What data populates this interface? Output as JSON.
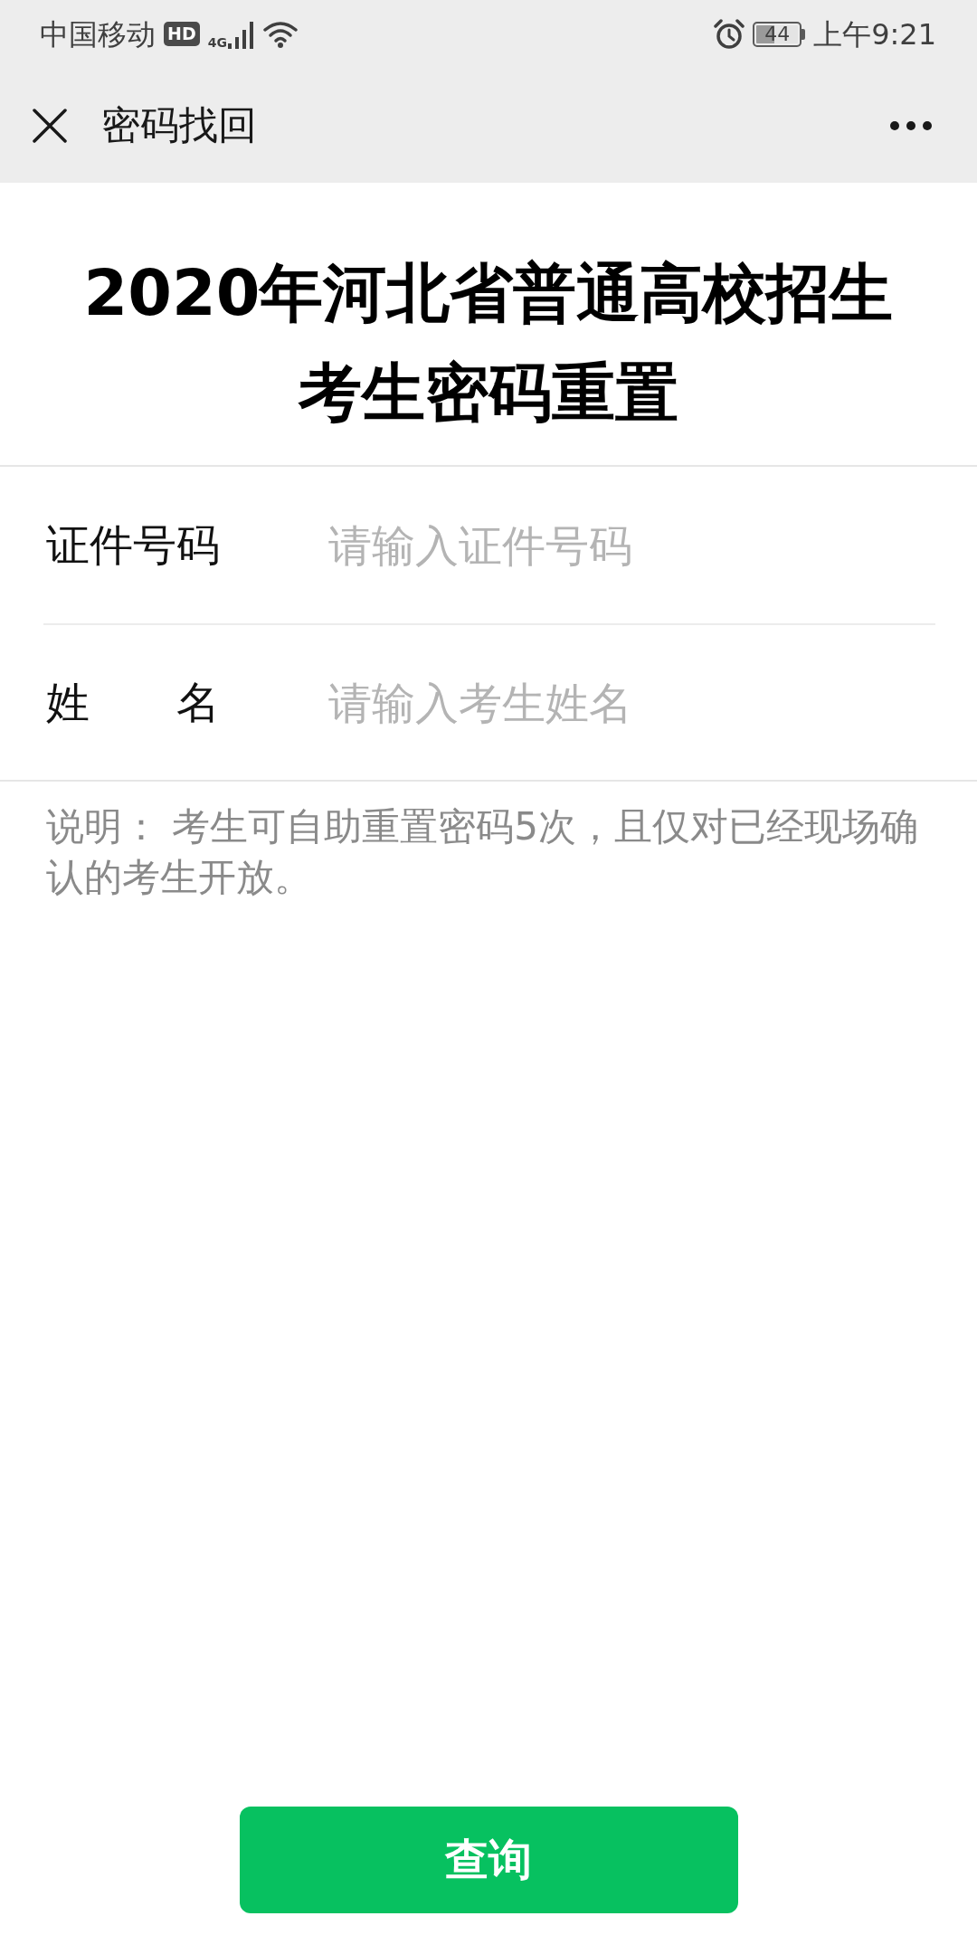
{
  "status_bar": {
    "carrier": "中国移动",
    "hd_badge": "HD",
    "network": "4G",
    "battery": "44",
    "time": "上午9:21"
  },
  "nav_bar": {
    "title": "密码找回"
  },
  "heading": {
    "lines": [
      "2020年河北省普通高校招生",
      "考生密码重置"
    ]
  },
  "form": {
    "fields": [
      {
        "label": "证件号码",
        "placeholder": "请输入证件号码"
      },
      {
        "label": "姓 名",
        "placeholder": "请输入考生姓名"
      }
    ]
  },
  "note": "说明： 考生可自助重置密码5次，且仅对已经现场确认的考生开放。",
  "button": {
    "label": "查询"
  }
}
